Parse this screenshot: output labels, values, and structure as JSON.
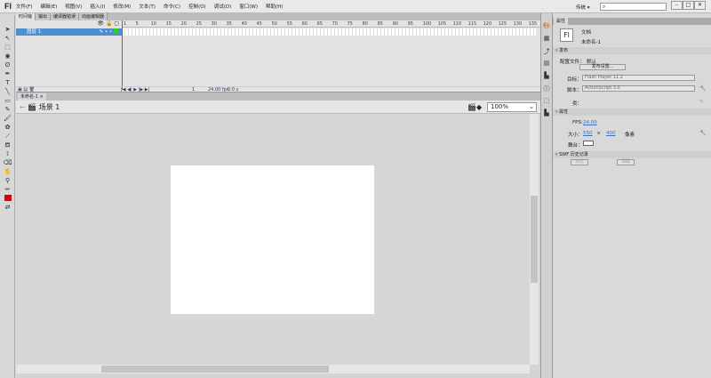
{
  "app": {
    "logo": "Fl"
  },
  "menu": [
    "文件(F)",
    "编辑(E)",
    "视图(V)",
    "插入(I)",
    "修改(M)",
    "文本(T)",
    "命令(C)",
    "控制(O)",
    "调试(D)",
    "窗口(W)",
    "帮助(H)"
  ],
  "workspace": "传统 ▾",
  "search": {
    "value": ""
  },
  "window_buttons": [
    "–",
    "□",
    "✕"
  ],
  "timeline": {
    "tabs": [
      "时间轴",
      "输出",
      "编译器错误",
      "动画编辑器"
    ],
    "active_tab": 0,
    "layer": "图层 1",
    "frame_ticks": [
      "1",
      "5",
      "10",
      "15",
      "20",
      "25",
      "30",
      "35",
      "40",
      "45",
      "50",
      "55",
      "60",
      "65",
      "70",
      "75",
      "80",
      "85",
      "90",
      "95",
      "100",
      "105",
      "110",
      "115",
      "120",
      "125",
      "130",
      "135"
    ],
    "current_frame": "1",
    "fps": "24.00 fps",
    "time": "0.0 s"
  },
  "document": {
    "tab": "未命名-1 ×",
    "scene": "场景 1",
    "zoom": "100%"
  },
  "properties": {
    "tab": "属性",
    "doc_type": "文档",
    "doc_name": "未命名-1",
    "publish_section": "发布",
    "profile_label": "配置文件：",
    "profile_value": "默认",
    "publish_settings": "发布设置...",
    "target_label": "目标：",
    "target_value": "Flash Player 11.2",
    "script_label": "脚本：",
    "script_value": "ActionScript 3.0",
    "class_label": "类：",
    "attr_section": "属性",
    "fps_label": "FPS:",
    "fps_value": "24.00",
    "size_label": "大小：",
    "width": "550",
    "x": "x",
    "height": "400",
    "unit": "像素",
    "stage_label": "舞台：",
    "stage_color": "#ffffff",
    "swf_section": "SWF 历史记录",
    "log": "日志",
    "clear": "清除"
  },
  "colors": {
    "layer_highlight": "#4f8fd0",
    "playhead": "#e33333",
    "fill": "#e00000"
  }
}
